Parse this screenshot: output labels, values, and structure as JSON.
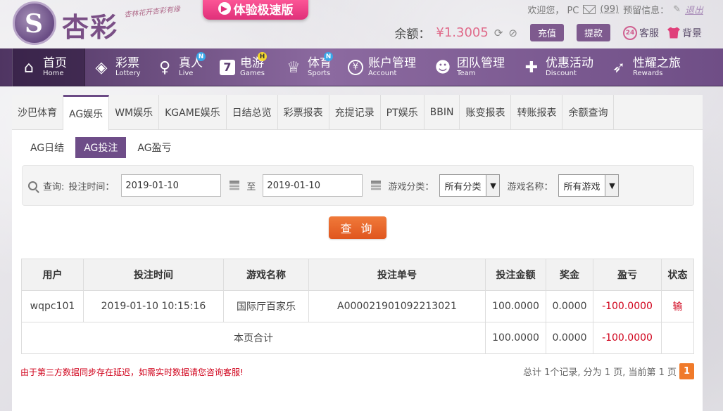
{
  "header": {
    "logo_text": "杏彩",
    "slogan": "杏林花开杏彩有缘",
    "speed_badge": "体验极速版",
    "welcome": "欢迎您， PC",
    "messages": "(99)",
    "warning_label": "预留信息：",
    "logout": "退出",
    "balance_label": "余额：",
    "balance_value": "¥1.3005",
    "deposit": "充值",
    "withdraw": "提款",
    "service": "客服",
    "background": "背景"
  },
  "nav": [
    {
      "zh": "首页",
      "en": "Home",
      "icon": "home-icon",
      "badge": ""
    },
    {
      "zh": "彩票",
      "en": "Lottery",
      "icon": "ticket-icon",
      "badge": ""
    },
    {
      "zh": "真人",
      "en": "Live",
      "icon": "woman-icon",
      "badge": "N"
    },
    {
      "zh": "电游",
      "en": "Games",
      "icon": "seven-icon",
      "badge": "H"
    },
    {
      "zh": "体育",
      "en": "Sports",
      "icon": "trophy-icon",
      "badge": "N"
    },
    {
      "zh": "账户管理",
      "en": "Account",
      "icon": "yen-icon",
      "badge": ""
    },
    {
      "zh": "团队管理",
      "en": "Team",
      "icon": "team-icon",
      "badge": ""
    },
    {
      "zh": "优惠活动",
      "en": "Discount",
      "icon": "gift-icon",
      "badge": ""
    },
    {
      "zh": "性耀之旅",
      "en": "Rewards",
      "icon": "rocket-icon",
      "badge": ""
    }
  ],
  "tabs": [
    "沙巴体育",
    "AG娱乐",
    "WM娱乐",
    "KGAME娱乐",
    "日结总览",
    "彩票报表",
    "充提记录",
    "PT娱乐",
    "BBIN",
    "账变报表",
    "转账报表",
    "余额查询"
  ],
  "subtabs": [
    "AG日结",
    "AG投注",
    "AG盈亏"
  ],
  "filter": {
    "query_label": "查询:",
    "time_label": "投注时间：",
    "date_from": "2019-01-10",
    "to_label": "至",
    "date_to": "2019-01-10",
    "category_label": "游戏分类：",
    "category_value": "所有分类",
    "game_label": "游戏名称：",
    "game_value": "所有游戏",
    "query_button": "查 询"
  },
  "table": {
    "headers": [
      "用户",
      "投注时间",
      "游戏名称",
      "投注单号",
      "投注金额",
      "奖金",
      "盈亏",
      "状态"
    ],
    "rows": [
      [
        "wqpc101",
        "2019-01-10 10:15:16",
        "国际厅百家乐",
        "A000021901092213021",
        "100.0000",
        "0.0000",
        "-100.0000",
        "输"
      ]
    ],
    "total": {
      "label": "本页合计",
      "amount": "100.0000",
      "bonus": "0.0000",
      "profit": "-100.0000"
    }
  },
  "footer": {
    "note": "由于第三方数据同步存在延迟，如需实时数据请您咨询客服!",
    "pager_text": "总计 1个记录, 分为 1 页, 当前第 1 页",
    "current_page": "1"
  }
}
